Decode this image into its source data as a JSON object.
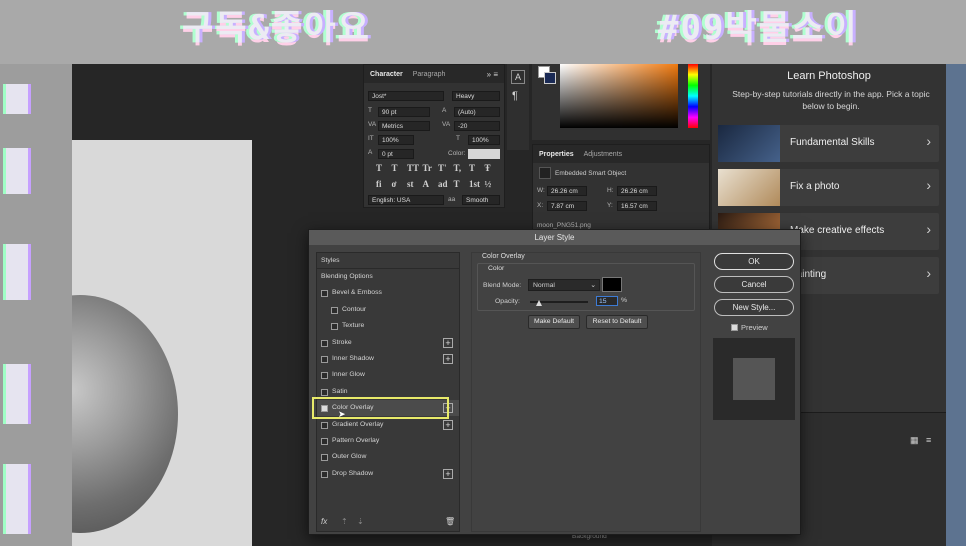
{
  "banner": {
    "left_text": "구독&좋아요",
    "right_text": "#09박물소이"
  },
  "character_panel": {
    "tabs": [
      "Character",
      "Paragraph"
    ],
    "font_family": "Jost*",
    "font_style": "Heavy",
    "font_size": "90 pt",
    "leading": "(Auto)",
    "kerning": "Metrics",
    "tracking": "-20",
    "vertical_scale": "100%",
    "horizontal_scale": "100%",
    "baseline_shift": "0 pt",
    "color_label": "Color:",
    "glyphs_row1": [
      "T",
      "T",
      "TT",
      "Tr",
      "T'",
      "T,",
      "T",
      "Ŧ"
    ],
    "glyphs_row2": [
      "fi",
      "ơ",
      "st",
      "A",
      "ad",
      "T",
      "1st",
      "½"
    ],
    "language": "English: USA",
    "aa_label": "aa",
    "antialias": "Smooth"
  },
  "properties_panel": {
    "tabs": [
      "Properties",
      "Adjustments"
    ],
    "type": "Embedded Smart Object",
    "w_label": "W:",
    "w": "26.26 cm",
    "h_label": "H:",
    "h": "26.26 cm",
    "x_label": "X:",
    "x": "7.87 cm",
    "y_label": "Y:",
    "y": "16.57 cm",
    "filename": "moon_PNG51.png"
  },
  "learn": {
    "title": "Learn Photoshop",
    "subtitle": "Step-by-step tutorials directly in the app. Pick a topic below to begin.",
    "cards": [
      {
        "label": "Fundamental Skills"
      },
      {
        "label": "Fix a photo"
      },
      {
        "label": "Make creative effects"
      },
      {
        "label": "Painting"
      }
    ]
  },
  "layers": {
    "bottom_label": "Background"
  },
  "dialog": {
    "title": "Layer Style",
    "styles_header": "Styles",
    "items": [
      {
        "label": "Blending Options",
        "check": false,
        "plus": false,
        "indent": 0,
        "header": true
      },
      {
        "label": "Bevel & Emboss",
        "check": true,
        "checked": false,
        "plus": false,
        "indent": 0
      },
      {
        "label": "Contour",
        "check": true,
        "checked": false,
        "plus": false,
        "indent": 1
      },
      {
        "label": "Texture",
        "check": true,
        "checked": false,
        "plus": false,
        "indent": 1
      },
      {
        "label": "Stroke",
        "check": true,
        "checked": false,
        "plus": true,
        "indent": 0
      },
      {
        "label": "Inner Shadow",
        "check": true,
        "checked": false,
        "plus": true,
        "indent": 0
      },
      {
        "label": "Inner Glow",
        "check": true,
        "checked": false,
        "plus": false,
        "indent": 0
      },
      {
        "label": "Satin",
        "check": true,
        "checked": false,
        "plus": false,
        "indent": 0
      },
      {
        "label": "Color Overlay",
        "check": true,
        "checked": true,
        "plus": true,
        "indent": 0
      },
      {
        "label": "Gradient Overlay",
        "check": true,
        "checked": false,
        "plus": true,
        "indent": 0
      },
      {
        "label": "Pattern Overlay",
        "check": true,
        "checked": false,
        "plus": false,
        "indent": 0
      },
      {
        "label": "Outer Glow",
        "check": true,
        "checked": false,
        "plus": false,
        "indent": 0
      },
      {
        "label": "Drop Shadow",
        "check": true,
        "checked": false,
        "plus": true,
        "indent": 0
      }
    ],
    "fx_label": "fx",
    "section_title": "Color Overlay",
    "group_title": "Color",
    "blend_mode_label": "Blend Mode:",
    "blend_mode": "Normal",
    "opacity_label": "Opacity:",
    "opacity": "15",
    "opacity_value": 0.15,
    "opacity_unit": "%",
    "overlay_color": "#000000",
    "make_default": "Make Default",
    "reset_default": "Reset to Default",
    "ok": "OK",
    "cancel": "Cancel",
    "new_style": "New Style...",
    "preview_label": "Preview",
    "preview_checked": true
  },
  "colors": {
    "highlight": "#e8ea6a",
    "accent_blue": "#3d7bd4"
  }
}
